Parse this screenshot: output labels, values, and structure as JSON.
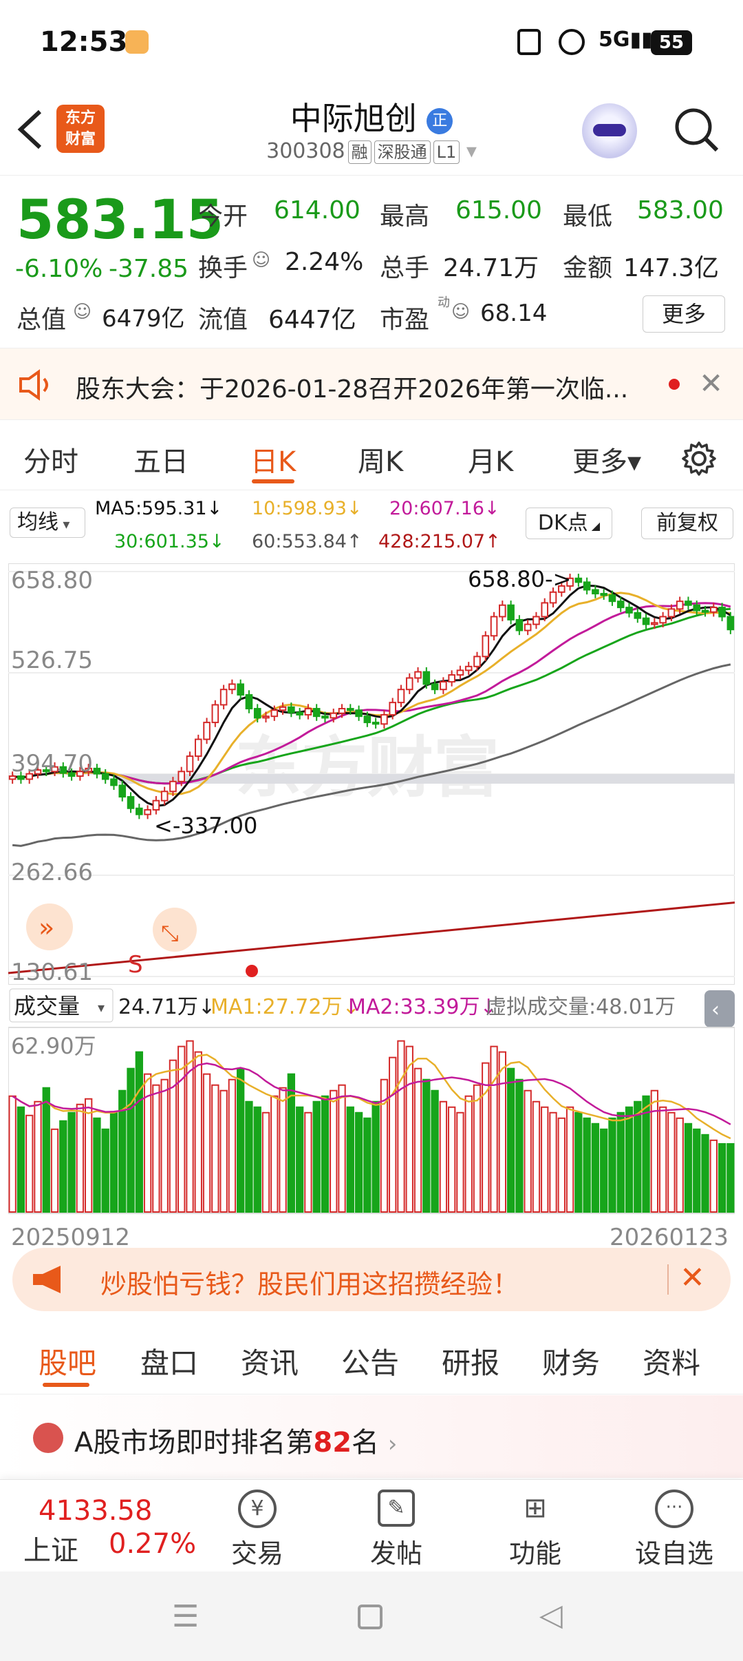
{
  "status": {
    "time": "12:53",
    "battery": "55"
  },
  "header": {
    "back_icon": "chevron-left-icon",
    "logo_line1": "东方",
    "logo_line2": "财富",
    "name": "中际旭创",
    "badge": "正",
    "code": "300308",
    "tags": [
      "融",
      "深股通",
      "L1"
    ]
  },
  "quote": {
    "price": "583.15",
    "change_pct": "-6.10%",
    "change": "-37.85",
    "open_label": "今开",
    "open": "614.00",
    "high_label": "最高",
    "high": "615.00",
    "low_label": "最低",
    "low": "583.00",
    "turnover_label": "换手",
    "turnover": "2.24%",
    "volume_label": "总手",
    "volume": "24.71万",
    "amount_label": "金额",
    "amount": "147.3亿",
    "mktcap_label": "总值",
    "mktcap": "6479亿",
    "float_label": "流值",
    "float": "6447亿",
    "pe_label": "市盈",
    "pe_sup": "动",
    "pe": "68.14",
    "more_button": "更多"
  },
  "notice": {
    "text": "股东大会：于2026-01-28召开2026年第一次临..."
  },
  "ktabs": [
    "分时",
    "五日",
    "日K",
    "周K",
    "月K",
    "更多▾"
  ],
  "ktab_active": 2,
  "ma": {
    "selector": "均线",
    "ma5": "MA5:595.31↓",
    "ma10": "10:598.93↓",
    "ma20": "20:607.16↓",
    "ma30": "30:601.35↓",
    "ma60": "60:553.84↑",
    "ma428": "428:215.07↑",
    "dk_button": "DK点",
    "adjust_button": "前复权"
  },
  "chart": {
    "y_labels": [
      "658.80",
      "526.75",
      "394.70",
      "262.66",
      "130.61"
    ],
    "max_label": "658.80->",
    "min_label": "<-337.00",
    "signal_label": "S",
    "volume_selector": "成交量",
    "volume_now": "24.71万↓",
    "vol_ma1": "MA1:27.72万↓",
    "vol_ma2": "MA2:33.39万↓",
    "virtual_volume": "虚拟成交量:48.01万",
    "vol_axis": "62.90万",
    "date_start": "20250912",
    "date_end": "20260123",
    "watermark": "东方财富",
    "colors": {
      "up": "#d42a2a",
      "down": "#17a51b",
      "ma5": "#111111",
      "ma10": "#e8b02a",
      "ma20": "#c21b9a",
      "ma30": "#17a51b",
      "ma60": "#666666",
      "ma428": "#b01818"
    }
  },
  "chart_data": {
    "type": "candlestick",
    "ylim": [
      130.61,
      658.8
    ],
    "y_ticks": [
      658.8,
      526.75,
      394.7,
      262.66,
      130.61
    ],
    "x_start": "20250912",
    "x_end": "20260123",
    "max_marker": 658.8,
    "min_marker": 337.0,
    "closes": [
      392,
      388,
      395,
      400,
      398,
      404,
      396,
      392,
      398,
      402,
      395,
      388,
      380,
      365,
      350,
      342,
      348,
      360,
      372,
      385,
      398,
      418,
      440,
      462,
      485,
      505,
      512,
      498,
      480,
      468,
      470,
      478,
      482,
      475,
      472,
      480,
      470,
      468,
      474,
      480,
      478,
      470,
      462,
      460,
      472,
      488,
      505,
      520,
      528,
      512,
      505,
      515,
      524,
      530,
      535,
      548,
      575,
      600,
      615,
      596,
      582,
      590,
      600,
      618,
      632,
      640,
      650,
      645,
      635,
      630,
      628,
      620,
      612,
      605,
      598,
      590,
      592,
      600,
      610,
      620,
      615,
      608,
      606,
      612,
      600,
      583.15
    ],
    "volumes": [
      42,
      38,
      35,
      40,
      45,
      30,
      33,
      36,
      39,
      41,
      34,
      30,
      36,
      44,
      52,
      58,
      50,
      46,
      48,
      55,
      60,
      62,
      58,
      50,
      46,
      44,
      48,
      52,
      40,
      38,
      36,
      42,
      45,
      50,
      38,
      36,
      40,
      42,
      44,
      46,
      38,
      36,
      34,
      40,
      48,
      56,
      62,
      60,
      52,
      48,
      44,
      40,
      38,
      36,
      42,
      46,
      54,
      60,
      58,
      52,
      48,
      44,
      40,
      38,
      36,
      34,
      38,
      36,
      34,
      32,
      30,
      34,
      36,
      38,
      40,
      42,
      44,
      38,
      36,
      34,
      32,
      30,
      28,
      26,
      24.71,
      24.71
    ],
    "ma5": 595.31,
    "ma10": 598.93,
    "ma20": 607.16,
    "ma30": 601.35,
    "ma60": 553.84,
    "ma428": 215.07
  },
  "ad": {
    "text": "炒股怕亏钱？股民们用这招攒经验！"
  },
  "btabs": [
    "股吧",
    "盘口",
    "资讯",
    "公告",
    "研报",
    "财务",
    "资料"
  ],
  "btab_active": 0,
  "rank": {
    "prefix": "A股市场即时排名第",
    "number": "82",
    "suffix": "名"
  },
  "bottombar": {
    "index_value": "4133.58",
    "index_name": "上证",
    "index_change": "0.27%",
    "trade": "交易",
    "post": "发帖",
    "func": "功能",
    "watch": "设自选"
  }
}
